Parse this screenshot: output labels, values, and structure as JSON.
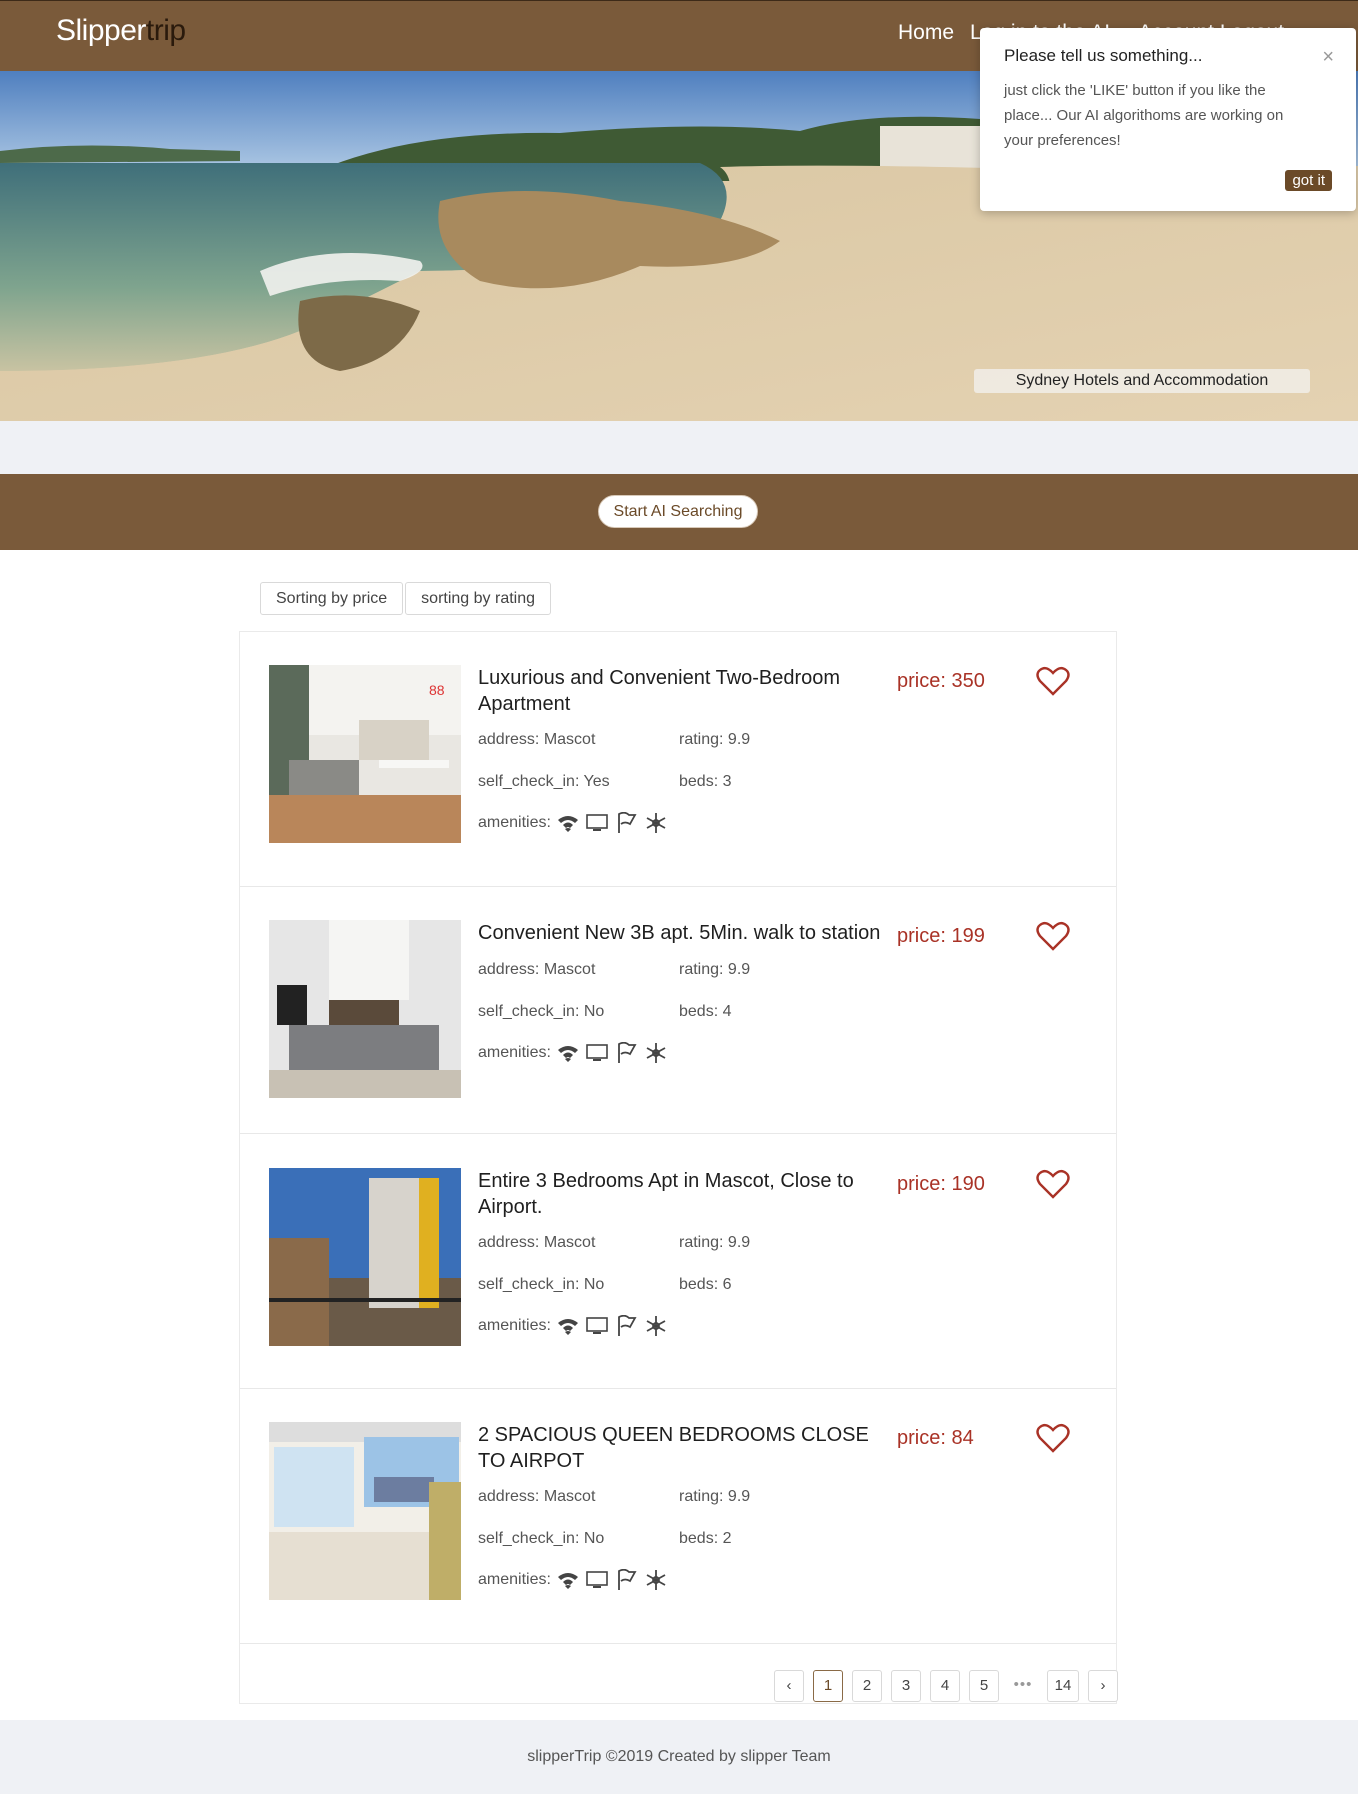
{
  "nav": {
    "logo_part1": "Slipper",
    "logo_part2": "trip",
    "home": "Home",
    "more": "Log in to the AI ...   Account   Logout"
  },
  "hero": {
    "caption": "Sydney Hotels and Accommodation"
  },
  "popup": {
    "title": "Please tell us something...",
    "close": "×",
    "body": "just click the 'LIKE' button if you like the place... Our AI algorithoms are working on your preferences!",
    "button": "got it"
  },
  "ai_button": "Start AI Searching",
  "sort": {
    "by_price": "Sorting by price",
    "by_rating": "sorting by rating"
  },
  "colors": {
    "brand_brown": "#7a5a3a",
    "price_red": "#a93226"
  },
  "listings": [
    {
      "title": "Luxurious and Convenient Two-Bedroom Apartment",
      "price": "price: 350",
      "address": "address: Mascot",
      "rating": "rating: 9.9",
      "self_check_in": "self_check_in: Yes",
      "beds": "beds: 3",
      "amenities_label": "amenities:",
      "icons": [
        "wifi-icon",
        "tv-icon",
        "flag-icon",
        "snowflake-icon"
      ]
    },
    {
      "title": "Convenient New 3B apt. 5Min. walk to station",
      "price": "price: 199",
      "address": "address: Mascot",
      "rating": "rating: 9.9",
      "self_check_in": "self_check_in: No",
      "beds": "beds: 4",
      "amenities_label": "amenities:",
      "icons": [
        "wifi-icon",
        "tv-icon",
        "flag-icon",
        "snowflake-icon"
      ]
    },
    {
      "title": "Entire 3 Bedrooms Apt in Mascot, Close to Airport.",
      "price": "price: 190",
      "address": "address: Mascot",
      "rating": "rating: 9.9",
      "self_check_in": "self_check_in: No",
      "beds": "beds: 6",
      "amenities_label": "amenities:",
      "icons": [
        "wifi-icon",
        "tv-icon",
        "flag-icon",
        "snowflake-icon"
      ]
    },
    {
      "title": "2 SPACIOUS QUEEN BEDROOMS CLOSE TO AIRPOT",
      "price": "price: 84",
      "address": "address: Mascot",
      "rating": "rating: 9.9",
      "self_check_in": "self_check_in: No",
      "beds": "beds: 2",
      "amenities_label": "amenities:",
      "icons": [
        "wifi-icon",
        "tv-icon",
        "flag-icon",
        "snowflake-icon"
      ]
    }
  ],
  "pagination": {
    "prev": "‹",
    "pages": [
      "1",
      "2",
      "3",
      "4",
      "5"
    ],
    "ellipsis": "•••",
    "last": "14",
    "next": "›",
    "current": "1"
  },
  "footer": "slipperTrip ©2019 Created by slipper Team"
}
